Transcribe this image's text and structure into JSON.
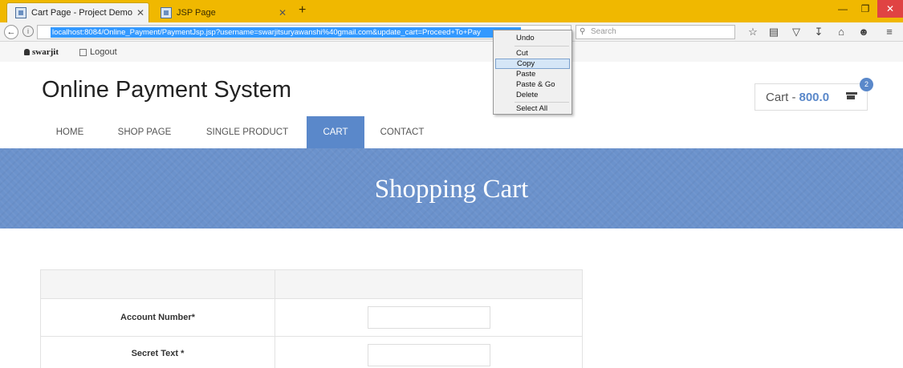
{
  "browser": {
    "tabs": [
      {
        "title": "Cart Page - Project Demo",
        "close": "✕"
      },
      {
        "title": "JSP Page",
        "close": "✕"
      }
    ],
    "new_tab": "+",
    "url": "localhost:8084/Online_Payment/PaymentJsp.jsp?username=swarjitsuryawanshi%40gmail.com&update_cart=Proceed+To+Pay",
    "search_placeholder": "Search"
  },
  "context_menu": {
    "items": [
      "Undo",
      "Cut",
      "Copy",
      "Paste",
      "Paste & Go",
      "Delete",
      "Select All"
    ],
    "highlighted": "Copy"
  },
  "user": {
    "name": "swarjit",
    "logout": "Logout"
  },
  "site": {
    "title": "Online Payment System"
  },
  "cart": {
    "label": "Cart -",
    "amount": "800.0",
    "count": "2"
  },
  "menu": {
    "items": [
      "HOME",
      "SHOP PAGE",
      "SINGLE PRODUCT",
      "CART",
      "CONTACT"
    ],
    "active": "CART"
  },
  "banner": {
    "title": "Shopping Cart"
  },
  "form": {
    "account_label": "Account Number*",
    "secret_label": "Secret Text *"
  },
  "colors": {
    "accent": "#5a88ca",
    "tabbar": "#f0b800",
    "selection": "#3399ff"
  }
}
